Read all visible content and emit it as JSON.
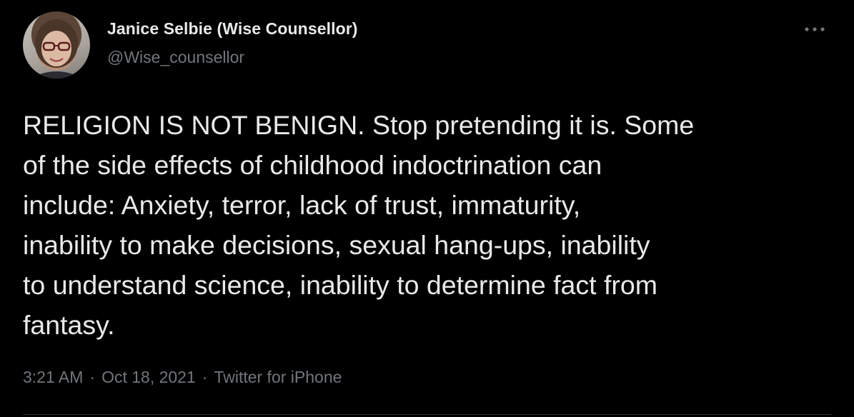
{
  "author": {
    "name": "Janice Selbie (Wise Counsellor)",
    "handle": "@Wise_counsellor",
    "avatar_icon": "profile-photo"
  },
  "menu": {
    "icon": "more-horizontal-icon"
  },
  "tweet": {
    "text": "RELIGION IS NOT BENIGN. Stop pretending it is. Some\nof the side effects of childhood indoctrination can\ninclude: Anxiety, terror, lack of trust, immaturity,\ninability to make decisions, sexual hang-ups, inability\nto understand science, inability to determine fact from\nfantasy."
  },
  "meta": {
    "time": "3:21 AM",
    "separator": "·",
    "date": "Oct 18, 2021",
    "source": "Twitter for iPhone"
  },
  "colors": {
    "background": "#000000",
    "primary_text": "#e7e9ea",
    "secondary_text": "#71767b",
    "divider": "#2f3336"
  }
}
